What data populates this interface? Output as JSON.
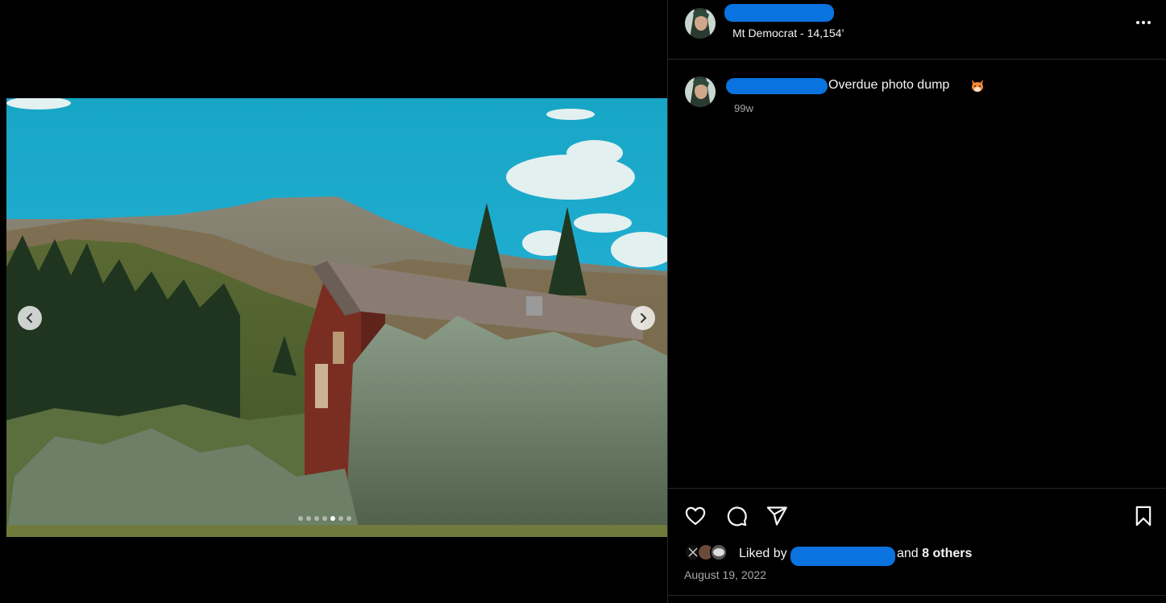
{
  "post": {
    "location": "Mt Democrat - 14,154’",
    "caption": "Overdue photo dump",
    "caption_emoji": "fox-face-emoji",
    "caption_time": "99w",
    "likes_prefix": "Liked by",
    "likes_and": "and",
    "likes_others": "8 others",
    "date": "August 19, 2022"
  },
  "carousel": {
    "slide_count": 7,
    "active_index": 4
  },
  "icons": {
    "more": "more-options-icon",
    "like": "heart-icon",
    "comment": "comment-icon",
    "share": "share-icon",
    "save": "bookmark-icon",
    "prev": "chevron-left-icon",
    "next": "chevron-right-icon"
  },
  "colors": {
    "background": "#000000",
    "divider": "#262626",
    "redaction": "#0a73e0",
    "secondary_text": "#a8a8a8"
  }
}
